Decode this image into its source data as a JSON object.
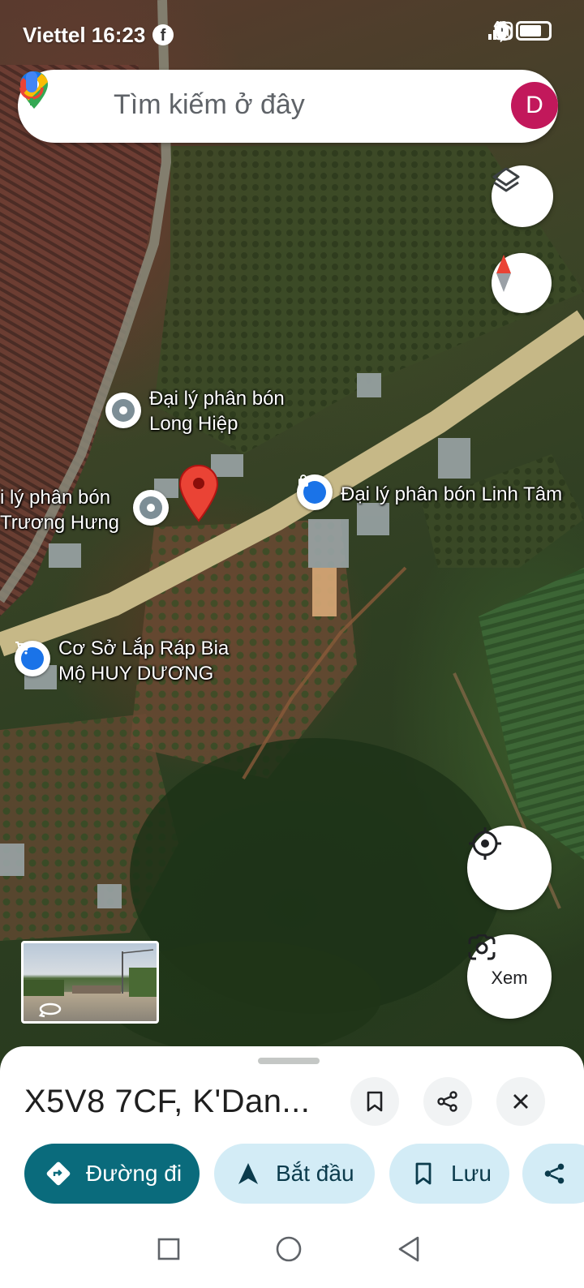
{
  "status_bar": {
    "carrier_time": "Viettel 16:23",
    "network": "4G"
  },
  "search": {
    "placeholder": "Tìm kiếm ở đây",
    "avatar_letter": "D"
  },
  "map": {
    "labels": {
      "long_hiep": [
        "Đại lý phân bón",
        "Long Hiệp"
      ],
      "truong_hung": [
        "i lý phân bón",
        "Trương Hưng"
      ],
      "linh_tam": "Đại lý phân bón Linh Tâm",
      "huy_duong": [
        "Cơ Sở Lắp Ráp Bia",
        "Mộ HUY DƯƠNG"
      ]
    },
    "icons": {
      "layers": "layers-icon",
      "compass": "compass-icon",
      "my_location": "crosshair-icon",
      "lens": "camera-lens-icon"
    },
    "lens_label": "Xem",
    "marker_color": "#ea4335"
  },
  "sheet": {
    "title": "X5V8 7CF, K'Dan...",
    "actions": {
      "directions": "Đường đi",
      "start": "Bắt đầu",
      "save": "Lưu"
    },
    "accent_color": "#0a6b7c",
    "chip_color": "#d3ecf6"
  }
}
